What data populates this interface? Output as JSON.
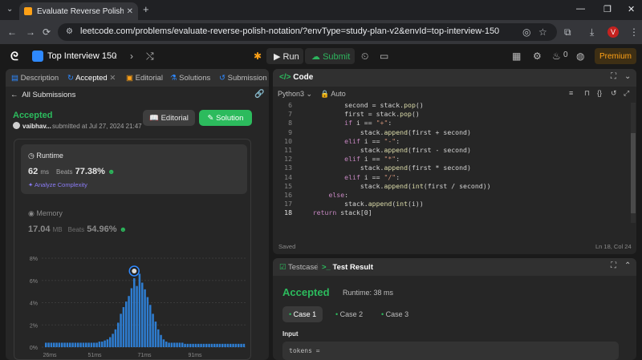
{
  "browser": {
    "tab_title": "Evaluate Reverse Polish Notatio",
    "url": "leetcode.com/problems/evaluate-reverse-polish-notation/?envType=study-plan-v2&envId=top-interview-150",
    "profile_initial": "V"
  },
  "nav": {
    "study_plan": "Top Interview 150",
    "run_label": "Run",
    "submit_label": "Submit",
    "streak_count": "0",
    "premium_label": "Premium"
  },
  "left": {
    "tabs": [
      {
        "label": "Description"
      },
      {
        "label": "Accepted"
      },
      {
        "label": "Editorial"
      },
      {
        "label": "Solutions"
      },
      {
        "label": "Submission"
      }
    ],
    "back_label": "All Submissions",
    "status": "Accepted",
    "user": "vaibhav...",
    "submitted_at": "submitted at Jul 27, 2024 21:47",
    "editorial_btn": "Editorial",
    "solution_btn": "Solution",
    "runtime": {
      "label": "Runtime",
      "value": "62",
      "unit": "ms",
      "beats_label": "Beats",
      "beats": "77.38%",
      "analyze": "Analyze Complexity"
    },
    "memory": {
      "label": "Memory",
      "value": "17.04",
      "unit": "MB",
      "beats_label": "Beats",
      "beats": "54.96%"
    }
  },
  "chart_data": {
    "type": "bar",
    "yticks": [
      "8%",
      "6%",
      "4%",
      "2%",
      "0%"
    ],
    "xticks": [
      "26ms",
      "51ms",
      "71ms",
      "91ms"
    ],
    "ylim": [
      0,
      8
    ],
    "values": [
      0.4,
      0.4,
      0.4,
      0.4,
      0.4,
      0.4,
      0.4,
      0.4,
      0.4,
      0.4,
      0.4,
      0.4,
      0.4,
      0.4,
      0.4,
      0.4,
      0.4,
      0.4,
      0.4,
      0.4,
      0.5,
      0.5,
      0.6,
      0.7,
      0.9,
      1.2,
      1.6,
      2.2,
      3.0,
      3.6,
      4.1,
      4.6,
      5.3,
      6.2,
      5.5,
      6.6,
      5.8,
      5.2,
      4.5,
      3.8,
      3.0,
      2.3,
      1.6,
      1.1,
      0.7,
      0.5,
      0.4,
      0.4,
      0.4,
      0.4,
      0.4,
      0.4,
      0.3,
      0.3,
      0.3,
      0.3,
      0.3,
      0.3,
      0.3,
      0.3,
      0.3,
      0.3,
      0.3,
      0.3,
      0.3,
      0.3,
      0.3,
      0.3,
      0.3,
      0.3,
      0.3,
      0.3,
      0.3,
      0.3,
      0.3
    ],
    "highlight_index": 33,
    "bar_color": "#2e7dd1",
    "grid": true
  },
  "code": {
    "header": "Code",
    "language": "Python3",
    "format": "Auto",
    "lines": [
      {
        "n": "",
        "text": "            second = stack.pop()"
      },
      {
        "n": "7",
        "text": "            first = stack.pop()"
      },
      {
        "n": "8",
        "text": "            if i == \"+\":"
      },
      {
        "n": "9",
        "text": "                stack.append(first + second)"
      },
      {
        "n": "10",
        "text": "            elif i == \"-\":"
      },
      {
        "n": "11",
        "text": "                stack.append(first - second)"
      },
      {
        "n": "12",
        "text": "            elif i == \"*\":"
      },
      {
        "n": "13",
        "text": "                stack.append(first * second)"
      },
      {
        "n": "14",
        "text": "            elif i == \"/\":"
      },
      {
        "n": "15",
        "text": "                stack.append(int(first / second))"
      },
      {
        "n": "16",
        "text": "        else:"
      },
      {
        "n": "17",
        "text": "            stack.append(int(i))"
      },
      {
        "n": "18",
        "text": "    return stack[0]"
      }
    ],
    "saved": "Saved",
    "cursor": "Ln 18, Col 24",
    "first_line_number": "6"
  },
  "test": {
    "testcase_tab": "Testcase",
    "result_tab": "Test Result",
    "status": "Accepted",
    "runtime": "Runtime: 38 ms",
    "cases": [
      {
        "label": "Case 1"
      },
      {
        "label": "Case 2"
      },
      {
        "label": "Case 3"
      }
    ],
    "input_label": "Input",
    "tokens": "tokens ="
  }
}
